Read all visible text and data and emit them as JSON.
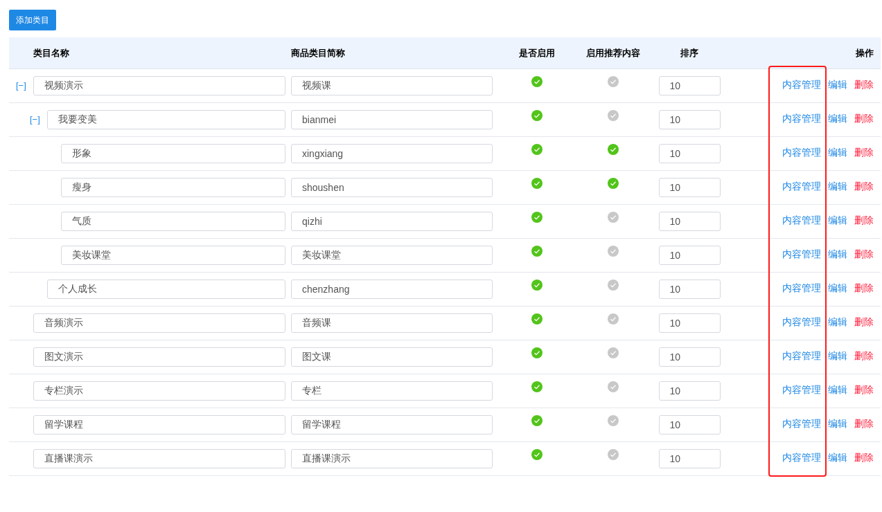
{
  "add_button": "添加类目",
  "columns": [
    "类目名称",
    "商品类目简称",
    "是否启用",
    "启用推荐内容",
    "排序",
    "操作"
  ],
  "rows": [
    {
      "name": "视频演示",
      "short_name": "视频课",
      "enabled": true,
      "recommended": false,
      "sort": "10",
      "toggle": "[−]",
      "expanded": true,
      "actions": [
        {
          "label": "内容管理",
          "kind": "link"
        },
        {
          "label": "编辑",
          "kind": "link"
        },
        {
          "label": "删除",
          "kind": "danger"
        }
      ],
      "children": [
        {
          "name": "我要变美",
          "short_name": "bianmei",
          "enabled": true,
          "recommended": false,
          "sort": "10",
          "toggle": "[−]",
          "expanded": true,
          "actions": [
            {
              "label": "内容管理",
              "kind": "link"
            },
            {
              "label": "编辑",
              "kind": "link"
            },
            {
              "label": "删除",
              "kind": "danger"
            }
          ],
          "children": [
            {
              "name": "形象",
              "short_name": "xingxiang",
              "enabled": true,
              "recommended": true,
              "sort": "10",
              "actions": [
                {
                  "label": "内容管理",
                  "kind": "link"
                },
                {
                  "label": "编辑",
                  "kind": "link"
                },
                {
                  "label": "删除",
                  "kind": "danger"
                }
              ]
            },
            {
              "name": "瘦身",
              "short_name": "shoushen",
              "enabled": true,
              "recommended": true,
              "sort": "10",
              "actions": [
                {
                  "label": "内容管理",
                  "kind": "link"
                },
                {
                  "label": "编辑",
                  "kind": "link"
                },
                {
                  "label": "删除",
                  "kind": "danger"
                }
              ]
            },
            {
              "name": "气质",
              "short_name": "qizhi",
              "enabled": true,
              "recommended": false,
              "sort": "10",
              "actions": [
                {
                  "label": "内容管理",
                  "kind": "link"
                },
                {
                  "label": "编辑",
                  "kind": "link"
                },
                {
                  "label": "删除",
                  "kind": "danger"
                }
              ]
            },
            {
              "name": "美妆课堂",
              "short_name": "美妆课堂",
              "enabled": true,
              "recommended": false,
              "sort": "10",
              "actions": [
                {
                  "label": "内容管理",
                  "kind": "link"
                },
                {
                  "label": "编辑",
                  "kind": "link"
                },
                {
                  "label": "删除",
                  "kind": "danger"
                }
              ]
            }
          ]
        },
        {
          "name": "个人成长",
          "short_name": "chenzhang",
          "enabled": true,
          "recommended": false,
          "sort": "10",
          "actions": [
            {
              "label": "内容管理",
              "kind": "link"
            },
            {
              "label": "编辑",
              "kind": "link"
            },
            {
              "label": "删除",
              "kind": "danger"
            }
          ]
        }
      ]
    },
    {
      "name": "音频演示",
      "short_name": "音频课",
      "enabled": true,
      "recommended": false,
      "sort": "10",
      "actions": [
        {
          "label": "内容管理",
          "kind": "link"
        },
        {
          "label": "编辑",
          "kind": "link"
        },
        {
          "label": "删除",
          "kind": "danger"
        }
      ]
    },
    {
      "name": "图文演示",
      "short_name": "图文课",
      "enabled": true,
      "recommended": false,
      "sort": "10",
      "actions": [
        {
          "label": "内容管理",
          "kind": "link"
        },
        {
          "label": "编辑",
          "kind": "link"
        },
        {
          "label": "删除",
          "kind": "danger"
        }
      ]
    },
    {
      "name": "专栏演示",
      "short_name": "专栏",
      "enabled": true,
      "recommended": false,
      "sort": "10",
      "actions": [
        {
          "label": "内容管理",
          "kind": "link"
        },
        {
          "label": "编辑",
          "kind": "link"
        },
        {
          "label": "删除",
          "kind": "danger"
        }
      ]
    },
    {
      "name": "留学课程",
      "short_name": "留学课程",
      "enabled": true,
      "recommended": false,
      "sort": "10",
      "actions": [
        {
          "label": "内容管理",
          "kind": "link"
        },
        {
          "label": "编辑",
          "kind": "link"
        },
        {
          "label": "删除",
          "kind": "danger"
        }
      ]
    },
    {
      "name": "直播课演示",
      "short_name": "直播课演示",
      "enabled": true,
      "recommended": false,
      "sort": "10",
      "actions": [
        {
          "label": "内容管理",
          "kind": "link"
        },
        {
          "label": "编辑",
          "kind": "link"
        },
        {
          "label": "删除",
          "kind": "danger"
        }
      ]
    }
  ]
}
